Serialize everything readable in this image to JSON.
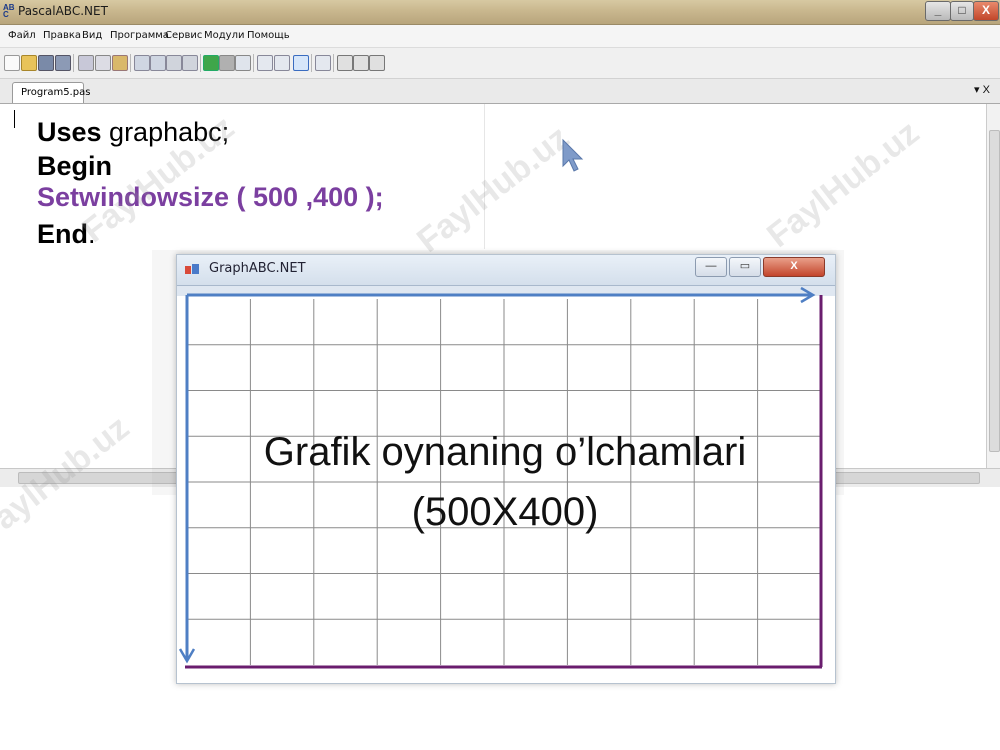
{
  "window": {
    "title": "PascalABC.NET",
    "controls": {
      "minimize": "_",
      "maximize": "□",
      "close": "X"
    }
  },
  "menu": [
    "Файл",
    "Правка",
    "Вид",
    "Программа",
    "Сервис",
    "Модули",
    "Помощь"
  ],
  "tab": {
    "label": "Program5.pas",
    "tools": "▾ X"
  },
  "code": {
    "line1_kw": "Uses",
    "line1_rest": " graphabc;",
    "line2_kw": "Begin",
    "line3": "Setwindowsize ( 500 ,400 );",
    "line4_kw": "End",
    "line4_rest": "."
  },
  "graph_window": {
    "title": "GraphABC.NET",
    "controls": {
      "minimize": "—",
      "maximize": "▭",
      "close": "X"
    }
  },
  "caption": {
    "line1": "Grafik oynaning o’lchamlari",
    "line2": "(500X400)"
  },
  "watermark": "FaylHub.uz",
  "colors": {
    "code_purple": "#7b3fa0",
    "frame_purple": "#6a1d6e",
    "arrow_blue": "#4f7fc4",
    "grid": "#8a8a8a"
  }
}
